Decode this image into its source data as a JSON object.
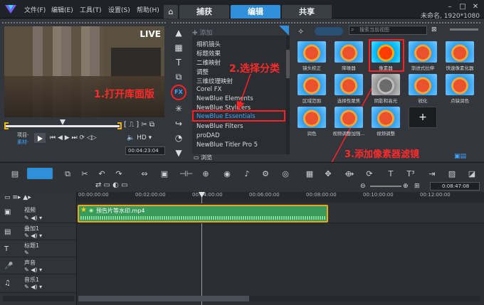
{
  "menu": [
    "文件(F)",
    "编辑(E)",
    "工具(T)",
    "设置(S)",
    "帮助(H)"
  ],
  "workspace_tabs": [
    "捕获",
    "编辑",
    "共享"
  ],
  "project_info": "未命名, 1920*1080",
  "player": {
    "live_label": "LIVE",
    "mode_project": "项目-",
    "mode_clip": "素材-",
    "timecode": "00:04:23:04"
  },
  "library": {
    "add_label": "添加",
    "browse_label": "浏览",
    "fx_label": "FX",
    "search_placeholder": "搜索当前视图",
    "categories": [
      "相机镜头",
      "标题效果",
      "二维映射",
      "调整",
      "三维纹理映射",
      "Corel FX",
      "NewBlue Elements",
      "NewBlue Stylizers",
      "NewBlue Essentials",
      "NewBlue Filters",
      "proDAD",
      "NewBlue Titler Pro 5"
    ],
    "selected_category": "NewBlue Essentials",
    "filters": [
      "镜头校正",
      "降噪器",
      "像素器",
      "渐进式拉伸",
      "快速像素化器",
      "区域范围",
      "选择性聚焦",
      "阴影和高光",
      "锐化",
      "点缺润色",
      "润色",
      "视频调整加强...",
      "视频调整"
    ],
    "selected_filter": "像素器"
  },
  "annotations": {
    "step1": "1.打开库面版",
    "step2": "2.选择分类",
    "step3": "3.添加像素器滤镜"
  },
  "timeline": {
    "ruler": [
      "00:00:00:00",
      "00:02:00:00",
      "00:04:00:00",
      "00:06:00:00",
      "00:08:00:00",
      "00:10:00:00",
      "00:12:00:00"
    ],
    "tracks": [
      "视频",
      "叠加1",
      "标题1",
      "声音",
      "音乐1"
    ],
    "clip_name": "预告片等水印.mp4",
    "timecode": "0:08:47:08"
  },
  "colors": {
    "accent": "#2f8fd8",
    "annotation": "#ff2020",
    "clip": "#3a9a5b"
  }
}
